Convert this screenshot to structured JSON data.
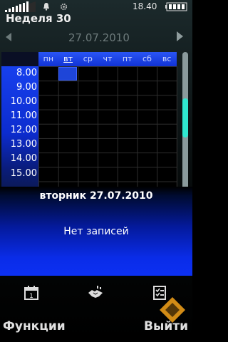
{
  "status_bar": {
    "time": "18.40"
  },
  "header": {
    "week_title": "Неделя 30",
    "date": "27.07.2010"
  },
  "calendar": {
    "days": [
      "пн",
      "вт",
      "ср",
      "чт",
      "пт",
      "сб",
      "вс"
    ],
    "selected_day_index": 1,
    "hours": [
      "8.00",
      "9.00",
      "10.00",
      "11.00",
      "12.00",
      "13.00",
      "14.00",
      "15.00"
    ]
  },
  "info_panel": {
    "date": "вторник 27.07.2010",
    "empty_text": "Нет записей"
  },
  "toolbar": {
    "icons": [
      "calendar-day-icon",
      "meeting-handshake-icon",
      "task-list-icon"
    ]
  },
  "softkeys": {
    "left": "Функции",
    "right": "Выйти"
  },
  "colors": {
    "accent_blue": "#1133d6",
    "scroll_thumb": "#2fe8d0"
  }
}
